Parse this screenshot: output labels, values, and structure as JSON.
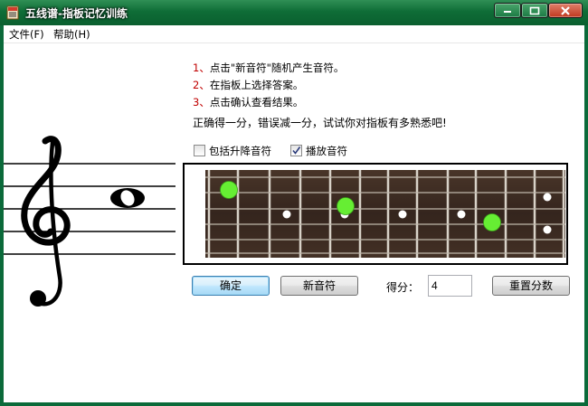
{
  "window": {
    "title": "五线谱-指板记忆训练",
    "controls": {
      "minimize": "minimize-icon",
      "maximize": "maximize-icon",
      "close": "close-icon"
    }
  },
  "menu": {
    "file": "文件(F)",
    "help": "帮助(H)"
  },
  "instructions": {
    "line1_num": "1、",
    "line1_text": "点击\"新音符\"随机产生音符。",
    "line2_num": "2、",
    "line2_text": "在指板上选择答案。",
    "line3_num": "3、",
    "line3_text": "点击确认查看结果。",
    "note": "正确得一分，错误减一分，试试你对指板有多熟悉吧!"
  },
  "options": {
    "include_accidentals": {
      "label": "包括升降音符",
      "checked": false
    },
    "play_sound": {
      "label": "播放音符",
      "checked": true
    }
  },
  "buttons": {
    "ok": "确定",
    "new_note": "新音符",
    "reset_score": "重置分数"
  },
  "score": {
    "label": "得分：",
    "value": "4"
  },
  "colors": {
    "title_bar": "#0f6d37",
    "fretboard_wood": "#3a2a22",
    "marker_green": "#66ee33",
    "instruction_number": "#c00000"
  }
}
